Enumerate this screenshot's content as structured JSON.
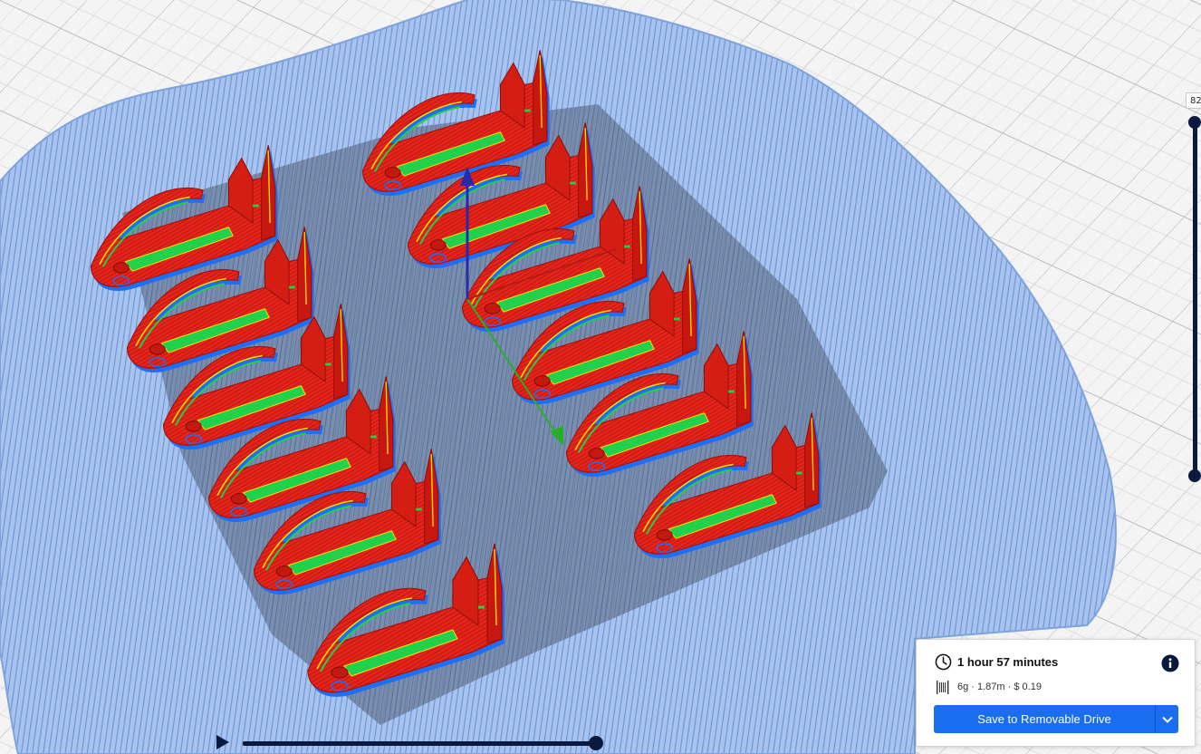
{
  "colors": {
    "background": "#f3f3f3",
    "build_plate_grid": "#c8c8c8",
    "raft": "#9dbbe8",
    "skin": "#e5251b",
    "infill": "#22d14b",
    "support": "#7ecfc8",
    "wall_outline": "#1e6ff5",
    "slider": "#0a1a3f",
    "primary_button": "#196ef0"
  },
  "layer_slider": {
    "current_layer_label": "82"
  },
  "print_info": {
    "clock_icon": "clock-icon",
    "print_time": "1 hour 57 minutes",
    "info_icon": "info-icon",
    "spool_icon": "filament-spool-icon",
    "material_summary": "6g · 1.87m · $ 0.19",
    "save_label": "Save to Removable Drive",
    "dropdown_icon": "chevron-down-icon"
  },
  "model_preview": {
    "object_count": 12,
    "arrangement": "grid 4x3 on raft",
    "axis_gizmo": [
      "x-axis-red",
      "y-axis-green",
      "z-axis-blue"
    ]
  }
}
